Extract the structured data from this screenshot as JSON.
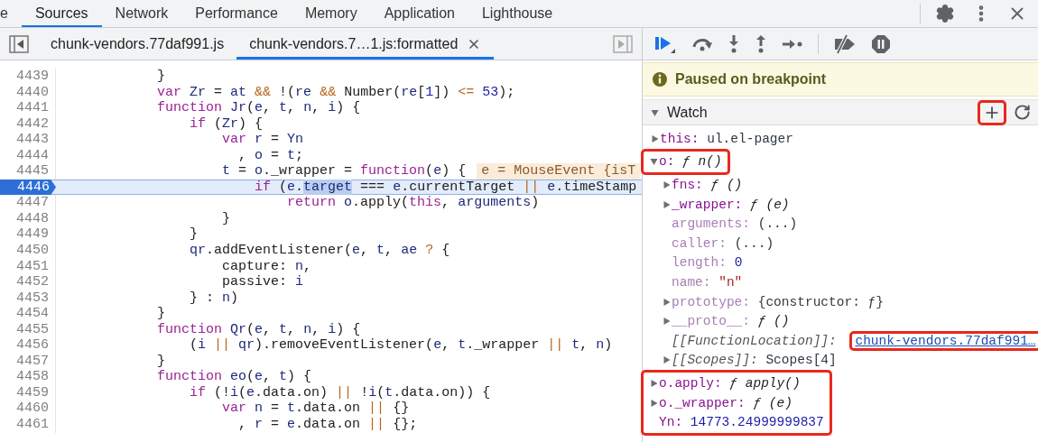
{
  "devtools_tabs": [
    {
      "label": "e",
      "selected": false
    },
    {
      "label": "Sources",
      "selected": true
    },
    {
      "label": "Network",
      "selected": false
    },
    {
      "label": "Performance",
      "selected": false
    },
    {
      "label": "Memory",
      "selected": false
    },
    {
      "label": "Application",
      "selected": false
    },
    {
      "label": "Lighthouse",
      "selected": false
    }
  ],
  "source_tabs": [
    {
      "label": "chunk-vendors.77daf991.js",
      "selected": false,
      "closable": false
    },
    {
      "label": "chunk-vendors.7…1.js:formatted",
      "selected": true,
      "closable": true
    }
  ],
  "code": {
    "lines": [
      {
        "number": "4439",
        "current": false,
        "tokens": [
          {
            "text": "            }",
            "kind": "plain"
          }
        ]
      },
      {
        "number": "4440",
        "current": false,
        "tokens": [
          {
            "text": "            var ",
            "kind": "keyword"
          },
          {
            "text": "Zr",
            "kind": "variable"
          },
          {
            "text": " = ",
            "kind": "plain"
          },
          {
            "text": "at ",
            "kind": "variable"
          },
          {
            "text": "&&",
            "kind": "operator"
          },
          {
            "text": " !(",
            "kind": "plain"
          },
          {
            "text": "re ",
            "kind": "variable"
          },
          {
            "text": "&&",
            "kind": "operator"
          },
          {
            "text": " Number(",
            "kind": "plain"
          },
          {
            "text": "re",
            "kind": "variable"
          },
          {
            "text": "[",
            "kind": "plain"
          },
          {
            "text": "1",
            "kind": "number"
          },
          {
            "text": "]) ",
            "kind": "plain"
          },
          {
            "text": "<= ",
            "kind": "operator"
          },
          {
            "text": "53",
            "kind": "number"
          },
          {
            "text": ");",
            "kind": "plain"
          }
        ]
      },
      {
        "number": "4441",
        "current": false,
        "tokens": [
          {
            "text": "            function ",
            "kind": "keyword"
          },
          {
            "text": "Jr",
            "kind": "variable"
          },
          {
            "text": "(",
            "kind": "plain"
          },
          {
            "text": "e",
            "kind": "variable"
          },
          {
            "text": ", ",
            "kind": "plain"
          },
          {
            "text": "t",
            "kind": "variable"
          },
          {
            "text": ", ",
            "kind": "plain"
          },
          {
            "text": "n",
            "kind": "variable"
          },
          {
            "text": ", ",
            "kind": "plain"
          },
          {
            "text": "i",
            "kind": "variable"
          },
          {
            "text": ") {",
            "kind": "plain"
          }
        ]
      },
      {
        "number": "4442",
        "current": false,
        "tokens": [
          {
            "text": "                if",
            "kind": "keyword"
          },
          {
            "text": " (",
            "kind": "plain"
          },
          {
            "text": "Zr",
            "kind": "variable"
          },
          {
            "text": ") {",
            "kind": "plain"
          }
        ]
      },
      {
        "number": "4443",
        "current": false,
        "tokens": [
          {
            "text": "                    var ",
            "kind": "keyword"
          },
          {
            "text": "r",
            "kind": "variable"
          },
          {
            "text": " = ",
            "kind": "plain"
          },
          {
            "text": "Yn",
            "kind": "variable"
          }
        ]
      },
      {
        "number": "4444",
        "current": false,
        "tokens": [
          {
            "text": "                      , ",
            "kind": "plain"
          },
          {
            "text": "o",
            "kind": "variable"
          },
          {
            "text": " = ",
            "kind": "plain"
          },
          {
            "text": "t",
            "kind": "variable"
          },
          {
            "text": ";",
            "kind": "plain"
          }
        ]
      },
      {
        "number": "4445",
        "current": false,
        "tokens": [
          {
            "text": "                    t",
            "kind": "variable"
          },
          {
            "text": " = ",
            "kind": "plain"
          },
          {
            "text": "o",
            "kind": "variable"
          },
          {
            "text": "._wrapper = ",
            "kind": "plain"
          },
          {
            "text": "function",
            "kind": "keyword"
          },
          {
            "text": "(",
            "kind": "plain"
          },
          {
            "text": "e",
            "kind": "variable"
          },
          {
            "text": ") {",
            "kind": "plain"
          }
        ],
        "inline_value": "e = MouseEvent {isT"
      },
      {
        "number": "4446",
        "current": true,
        "tokens": [
          {
            "text": "                        if",
            "kind": "keyword"
          },
          {
            "text": " (",
            "kind": "plain"
          },
          {
            "text": "e",
            "kind": "variable"
          },
          {
            "text": ".",
            "kind": "plain"
          },
          {
            "text": "target",
            "kind": "selection"
          },
          {
            "text": " === ",
            "kind": "plain"
          },
          {
            "text": "e",
            "kind": "variable"
          },
          {
            "text": ".currentTarget ",
            "kind": "plain"
          },
          {
            "text": "|| ",
            "kind": "operator"
          },
          {
            "text": "e",
            "kind": "variable"
          },
          {
            "text": ".timeStamp",
            "kind": "plain"
          }
        ]
      },
      {
        "number": "4447",
        "current": false,
        "tokens": [
          {
            "text": "                            return ",
            "kind": "keyword"
          },
          {
            "text": "o",
            "kind": "variable"
          },
          {
            "text": ".apply(",
            "kind": "plain"
          },
          {
            "text": "this",
            "kind": "keyword"
          },
          {
            "text": ", ",
            "kind": "plain"
          },
          {
            "text": "arguments",
            "kind": "variable"
          },
          {
            "text": ")",
            "kind": "plain"
          }
        ]
      },
      {
        "number": "4448",
        "current": false,
        "tokens": [
          {
            "text": "                    }",
            "kind": "plain"
          }
        ]
      },
      {
        "number": "4449",
        "current": false,
        "tokens": [
          {
            "text": "                }",
            "kind": "plain"
          }
        ]
      },
      {
        "number": "4450",
        "current": false,
        "tokens": [
          {
            "text": "                qr",
            "kind": "variable"
          },
          {
            "text": ".addEventListener(",
            "kind": "plain"
          },
          {
            "text": "e",
            "kind": "variable"
          },
          {
            "text": ", ",
            "kind": "plain"
          },
          {
            "text": "t",
            "kind": "variable"
          },
          {
            "text": ", ",
            "kind": "plain"
          },
          {
            "text": "ae ",
            "kind": "variable"
          },
          {
            "text": "?",
            "kind": "operator"
          },
          {
            "text": " {",
            "kind": "plain"
          }
        ]
      },
      {
        "number": "4451",
        "current": false,
        "tokens": [
          {
            "text": "                    capture: ",
            "kind": "plain"
          },
          {
            "text": "n",
            "kind": "variable"
          },
          {
            "text": ",",
            "kind": "plain"
          }
        ]
      },
      {
        "number": "4452",
        "current": false,
        "tokens": [
          {
            "text": "                    passive: ",
            "kind": "plain"
          },
          {
            "text": "i",
            "kind": "variable"
          }
        ]
      },
      {
        "number": "4453",
        "current": false,
        "tokens": [
          {
            "text": "                } : ",
            "kind": "plain"
          },
          {
            "text": "n",
            "kind": "variable"
          },
          {
            "text": ")",
            "kind": "plain"
          }
        ]
      },
      {
        "number": "4454",
        "current": false,
        "tokens": [
          {
            "text": "            }",
            "kind": "plain"
          }
        ]
      },
      {
        "number": "4455",
        "current": false,
        "tokens": [
          {
            "text": "            function ",
            "kind": "keyword"
          },
          {
            "text": "Qr",
            "kind": "variable"
          },
          {
            "text": "(",
            "kind": "plain"
          },
          {
            "text": "e",
            "kind": "variable"
          },
          {
            "text": ", ",
            "kind": "plain"
          },
          {
            "text": "t",
            "kind": "variable"
          },
          {
            "text": ", ",
            "kind": "plain"
          },
          {
            "text": "n",
            "kind": "variable"
          },
          {
            "text": ", ",
            "kind": "plain"
          },
          {
            "text": "i",
            "kind": "variable"
          },
          {
            "text": ") {",
            "kind": "plain"
          }
        ]
      },
      {
        "number": "4456",
        "current": false,
        "tokens": [
          {
            "text": "                (",
            "kind": "plain"
          },
          {
            "text": "i ",
            "kind": "variable"
          },
          {
            "text": "|| ",
            "kind": "operator"
          },
          {
            "text": "qr",
            "kind": "variable"
          },
          {
            "text": ").removeEventListener(",
            "kind": "plain"
          },
          {
            "text": "e",
            "kind": "variable"
          },
          {
            "text": ", ",
            "kind": "plain"
          },
          {
            "text": "t",
            "kind": "variable"
          },
          {
            "text": "._wrapper ",
            "kind": "plain"
          },
          {
            "text": "|| ",
            "kind": "operator"
          },
          {
            "text": "t",
            "kind": "variable"
          },
          {
            "text": ", ",
            "kind": "plain"
          },
          {
            "text": "n",
            "kind": "variable"
          },
          {
            "text": ")",
            "kind": "plain"
          }
        ]
      },
      {
        "number": "4457",
        "current": false,
        "tokens": [
          {
            "text": "            }",
            "kind": "plain"
          }
        ]
      },
      {
        "number": "4458",
        "current": false,
        "tokens": [
          {
            "text": "            function ",
            "kind": "keyword"
          },
          {
            "text": "eo",
            "kind": "variable"
          },
          {
            "text": "(",
            "kind": "plain"
          },
          {
            "text": "e",
            "kind": "variable"
          },
          {
            "text": ", ",
            "kind": "plain"
          },
          {
            "text": "t",
            "kind": "variable"
          },
          {
            "text": ") {",
            "kind": "plain"
          }
        ]
      },
      {
        "number": "4459",
        "current": false,
        "tokens": [
          {
            "text": "                if",
            "kind": "keyword"
          },
          {
            "text": " (!",
            "kind": "plain"
          },
          {
            "text": "i",
            "kind": "variable"
          },
          {
            "text": "(",
            "kind": "plain"
          },
          {
            "text": "e",
            "kind": "variable"
          },
          {
            "text": ".data.on) ",
            "kind": "plain"
          },
          {
            "text": "||",
            "kind": "operator"
          },
          {
            "text": " !",
            "kind": "plain"
          },
          {
            "text": "i",
            "kind": "variable"
          },
          {
            "text": "(",
            "kind": "plain"
          },
          {
            "text": "t",
            "kind": "variable"
          },
          {
            "text": ".data.on)) {",
            "kind": "plain"
          }
        ]
      },
      {
        "number": "4460",
        "current": false,
        "tokens": [
          {
            "text": "                    var ",
            "kind": "keyword"
          },
          {
            "text": "n",
            "kind": "variable"
          },
          {
            "text": " = ",
            "kind": "plain"
          },
          {
            "text": "t",
            "kind": "variable"
          },
          {
            "text": ".data.on ",
            "kind": "plain"
          },
          {
            "text": "||",
            "kind": "operator"
          },
          {
            "text": " {}",
            "kind": "plain"
          }
        ]
      },
      {
        "number": "4461",
        "current": false,
        "tokens": [
          {
            "text": "                      , ",
            "kind": "plain"
          },
          {
            "text": "r",
            "kind": "variable"
          },
          {
            "text": " = ",
            "kind": "plain"
          },
          {
            "text": "e",
            "kind": "variable"
          },
          {
            "text": ".data.on ",
            "kind": "plain"
          },
          {
            "text": "||",
            "kind": "operator"
          },
          {
            "text": " {};",
            "kind": "plain"
          }
        ]
      }
    ]
  },
  "debugger": {
    "paused_message": "Paused on breakpoint",
    "watch": {
      "title": "Watch",
      "expanded": true,
      "add_highlighted": true,
      "items": [
        {
          "name": "this:",
          "value": {
            "text": "ul.el-pager",
            "kind": "object"
          },
          "kind": "property",
          "expanded": false,
          "highlighted": false
        },
        {
          "name": "o:",
          "value": {
            "text": "ƒ n()",
            "kind": "function"
          },
          "kind": "property",
          "expanded": true,
          "highlighted": true,
          "children": [
            {
              "name": "fns:",
              "value": {
                "text": "ƒ ()",
                "kind": "function"
              },
              "kind": "property",
              "expanded": false,
              "highlighted": false
            },
            {
              "name": "_wrapper:",
              "value": {
                "text": "ƒ (e)",
                "kind": "function"
              },
              "kind": "property",
              "expanded": false,
              "highlighted": false
            },
            {
              "name": "arguments:",
              "value": {
                "text": "(...)",
                "kind": "unavailable"
              },
              "kind": "hidden",
              "highlighted": false
            },
            {
              "name": "caller:",
              "value": {
                "text": "(...)",
                "kind": "unavailable"
              },
              "kind": "hidden",
              "highlighted": false
            },
            {
              "name": "length:",
              "value": {
                "text": "0",
                "kind": "number"
              },
              "kind": "hidden",
              "highlighted": false
            },
            {
              "name": "name:",
              "value": {
                "text": "\"n\"",
                "kind": "string"
              },
              "kind": "hidden",
              "highlighted": false
            },
            {
              "name": "prototype:",
              "value": {
                "text": "{constructor: ƒ}",
                "kind": "object"
              },
              "kind": "hidden",
              "expanded": false,
              "highlighted": false
            },
            {
              "name": "__proto__:",
              "value": {
                "text": "ƒ ()",
                "kind": "function"
              },
              "kind": "hidden",
              "expanded": false,
              "highlighted": false
            },
            {
              "name": "[[FunctionLocation]]:",
              "value": {
                "text": "chunk-vendors.77daf991…",
                "kind": "link"
              },
              "kind": "internal",
              "highlighted": true
            },
            {
              "name": "[[Scopes]]:",
              "value": {
                "text": "Scopes[4]",
                "kind": "object"
              },
              "kind": "internal",
              "expanded": false,
              "highlighted": false
            }
          ]
        },
        {
          "name": "o.apply:",
          "value": {
            "text": "ƒ apply()",
            "kind": "function"
          },
          "kind": "property",
          "expanded": false,
          "highlighted": true
        },
        {
          "name": "o._wrapper:",
          "value": {
            "text": "ƒ (e)",
            "kind": "function"
          },
          "kind": "property",
          "expanded": false,
          "highlighted": true
        },
        {
          "name": "Yn:",
          "value": {
            "text": "14773.24999999837",
            "kind": "number"
          },
          "kind": "property",
          "highlighted": true
        }
      ]
    }
  }
}
